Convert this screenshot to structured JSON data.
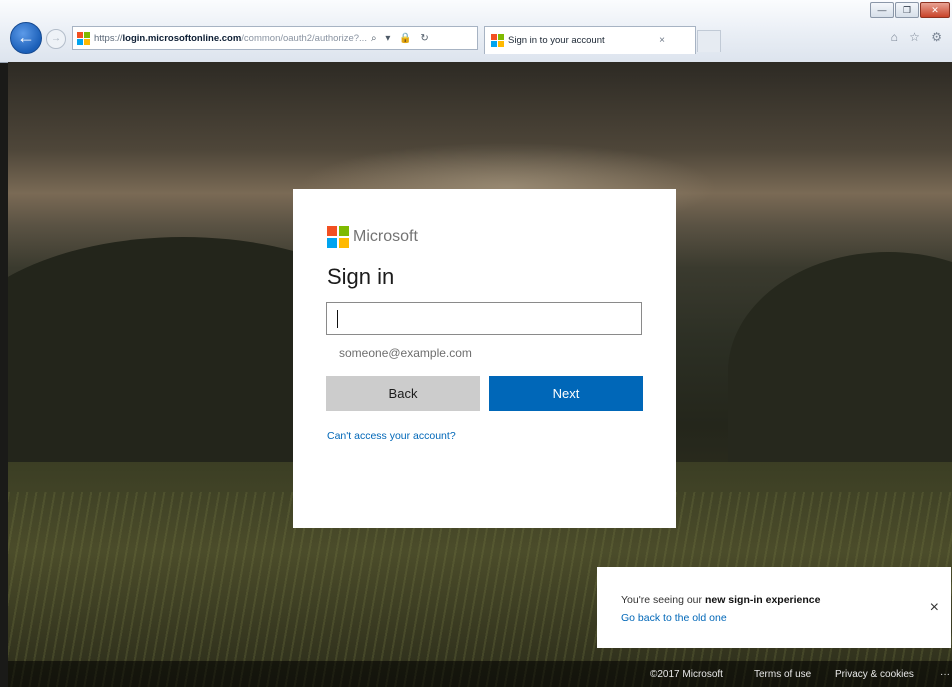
{
  "browser": {
    "address": {
      "prefix": "https://",
      "host": "login.microsoftonline.com",
      "rest": "/common/oauth2/authorize?...",
      "icons": "⌕ ▾ 🔒 ↻"
    },
    "tab": {
      "title": "Sign in to your account",
      "close": "×"
    },
    "window_controls": {
      "minimize": "—",
      "restore": "❐",
      "close": "✕"
    },
    "right_icons": "⌂ ☆ ⚙",
    "back_glyph": "←",
    "forward_glyph": "→"
  },
  "brand": {
    "logo_colors": [
      "#f25022",
      "#7fba00",
      "#00a4ef",
      "#ffb900"
    ],
    "name": "Microsoft"
  },
  "signin": {
    "title": "Sign in",
    "email_value": "",
    "hint": "someone@example.com",
    "back_label": "Back",
    "next_label": "Next",
    "cant_access": "Can't access your account?"
  },
  "toast": {
    "text_prefix": "You're seeing our ",
    "text_bold": "new sign-in experience",
    "link": "Go back to the old one",
    "close": "×"
  },
  "footer": {
    "copyright": "©2017 Microsoft",
    "terms": "Terms of use",
    "privacy": "Privacy & cookies",
    "more": "···"
  },
  "colors": {
    "accent": "#0067b8",
    "back_button": "#cccccc"
  }
}
